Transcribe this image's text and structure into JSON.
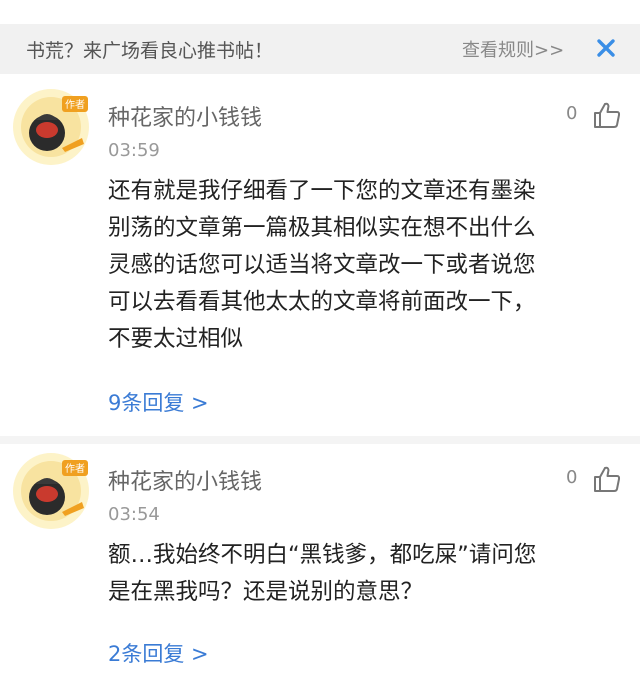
{
  "banner": {
    "text": "书荒？来广场看良心推书帖！",
    "link": "查看规则>>",
    "close_icon": "close-icon",
    "accent": "#3a8ee6"
  },
  "comments": [
    {
      "username": "种花家的小钱钱",
      "badge": "作者",
      "time": "03:59",
      "likes": "0",
      "lines": [
        "还有就是我仔细看了一下您的文章还有墨染",
        "别荡的文章第一篇极其相似实在想不出什么",
        "灵感的话您可以适当将文章改一下或者说您",
        "可以去看看其他太太的文章将前面改一下，",
        "不要太过相似"
      ],
      "replies": "9条回复 >"
    },
    {
      "username": "种花家的小钱钱",
      "badge": "作者",
      "time": "03:54",
      "likes": "0",
      "lines": [
        "额…我始终不明白“黑钱爹，都吃屎”请问您",
        "是在黑我吗？还是说别的意思？"
      ],
      "replies": "2条回复 >"
    }
  ],
  "colors": {
    "link": "#3a7bd5",
    "banner_bg": "#f1f1f1",
    "badge": "#f0a020"
  }
}
